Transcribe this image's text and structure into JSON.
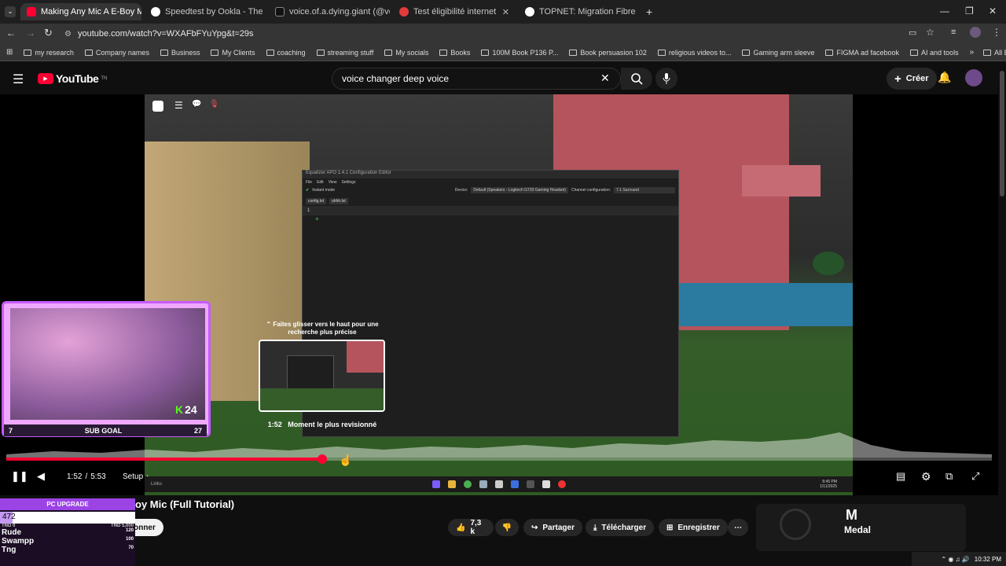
{
  "tabs": [
    {
      "label": "Making Any Mic A E-Boy M",
      "color": "#ff0033",
      "active": true
    },
    {
      "label": "Speedtest by Ookla - The Glob",
      "color": "#ffffff",
      "active": false
    },
    {
      "label": "voice.of.a.dying.giant (@voice.",
      "color": "#111111",
      "active": false
    },
    {
      "label": "Test éligibilité internet",
      "color": "#e23b3b",
      "active": false
    },
    {
      "label": "TOPNET: Migration Fibre",
      "color": "#ffffff",
      "active": false
    }
  ],
  "address": {
    "url": "youtube.com/watch?v=WXAFbFYuYpg&t=29s"
  },
  "bookmarks": [
    "my research",
    "Company names",
    "Business",
    "My Clients",
    "coaching",
    "streaming stuff",
    "My socials",
    "Books",
    "100M Book P136 P...",
    "Book persuasion 102",
    "religious videos to...",
    "Gaming arm sleeve",
    "FIGMA ad facebook",
    "AI and tools"
  ],
  "bookmarks_all": "All Bookmarks",
  "yt": {
    "logo_text": "YouTube",
    "logo_country": "TN",
    "search_value": "voice changer deep voice",
    "create_label": "Créer"
  },
  "eq_window": {
    "title": "Equalizer APO 1.4.1 Configuration Editor",
    "menu": [
      "File",
      "Edit",
      "View",
      "Settings"
    ],
    "instant_mode": "Instant mode",
    "device_label": "Device:",
    "device_value": "Default (Speakers - Logitech G733 Gaming Headset)",
    "channel_label": "Channel configuration:",
    "channel_value": "7.1 Surround",
    "tabs": [
      "config.txt",
      "uhhh.txt"
    ],
    "line_number": "1"
  },
  "webcam": {
    "sub_goal": "SUB GOAL",
    "goal_current": "7",
    "goal_target": "27",
    "badge_letter": "K",
    "badge_number": "24"
  },
  "preview": {
    "hint": "⌃ Faites glisser vers le haut pour une recherche plus précise",
    "time": "1:52",
    "caption": "Moment le plus revisionné"
  },
  "player": {
    "progress": 0.3208,
    "time_current": "1:52",
    "time_total": "5:53",
    "chapter": "Setup"
  },
  "inner_taskbar": {
    "left_text": "Links",
    "clock": "8:45 PM",
    "date": "1/11/2025"
  },
  "video_title": "oy Mic (Full Tutorial)",
  "subscribe_fragment": "onner",
  "actions": {
    "likes": "7,3 k",
    "share": "Partager",
    "download": "Télécharger",
    "save": "Enregistrer"
  },
  "medal": {
    "name": "Medal"
  },
  "pc_upgrade": {
    "title": "PC UPGRADE",
    "value": "472",
    "min_label": "TND 0",
    "max_label": "TND 5,000",
    "rows": [
      {
        "name": "Rude",
        "score": "120"
      },
      {
        "name": "Swampp",
        "score": "100"
      },
      {
        "name": "Tng",
        "score": "70"
      }
    ]
  },
  "system_clock": "10:32 PM"
}
